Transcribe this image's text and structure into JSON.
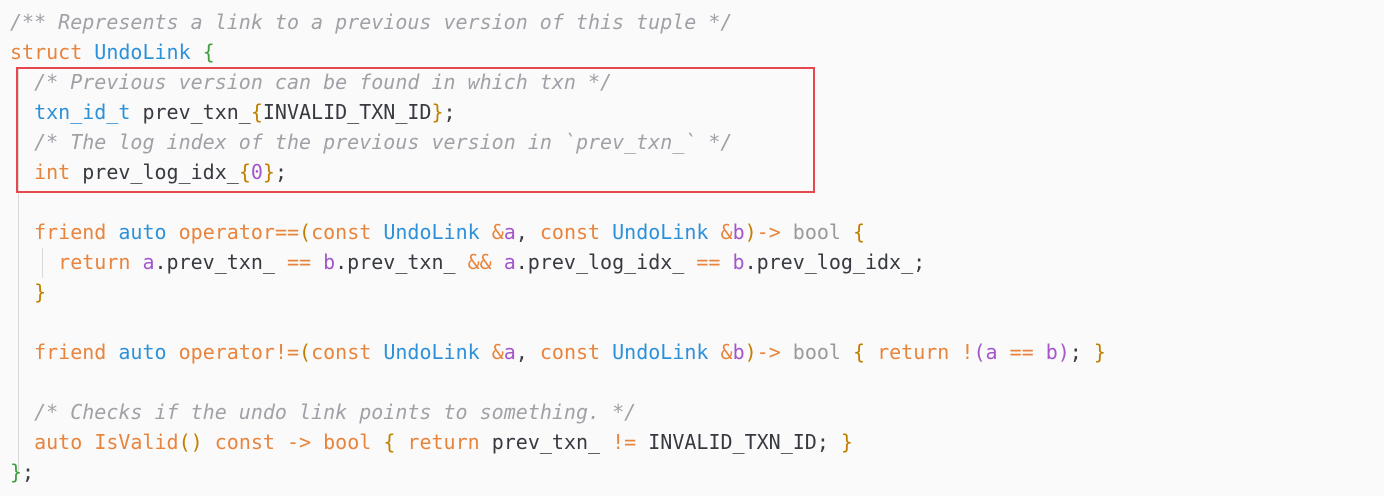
{
  "editor": {
    "language": "cpp",
    "highlight_color": "#e5484d",
    "lines": [
      {
        "id": "l1",
        "tokens": [
          [
            "cm",
            "/** Represents a link to a previous version of this tuple */"
          ]
        ]
      },
      {
        "id": "l2",
        "tokens": [
          [
            "kw",
            "struct "
          ],
          [
            "ty",
            "UndoLink "
          ],
          [
            "gr",
            "{"
          ]
        ]
      },
      {
        "id": "l3",
        "tokens": [
          [
            "pl",
            "  "
          ],
          [
            "cm",
            "/* Previous version can be found in which txn */"
          ]
        ]
      },
      {
        "id": "l4",
        "tokens": [
          [
            "pl",
            "  "
          ],
          [
            "ty",
            "txn_id_t "
          ],
          [
            "id",
            "prev_txn_"
          ],
          [
            "br1",
            "{"
          ],
          [
            "id",
            "INVALID_TXN_ID"
          ],
          [
            "br1",
            "}"
          ],
          [
            "pl",
            ";"
          ]
        ]
      },
      {
        "id": "l5",
        "tokens": [
          [
            "pl",
            "  "
          ],
          [
            "cm",
            "/* The log index of the previous version in `prev_txn_` */"
          ]
        ]
      },
      {
        "id": "l6",
        "tokens": [
          [
            "pl",
            "  "
          ],
          [
            "kw",
            "int "
          ],
          [
            "id",
            "prev_log_idx_"
          ],
          [
            "br1",
            "{"
          ],
          [
            "nm",
            "0"
          ],
          [
            "br1",
            "}"
          ],
          [
            "pl",
            ";"
          ]
        ]
      },
      {
        "id": "l7",
        "tokens": []
      },
      {
        "id": "l8",
        "tokens": [
          [
            "pl",
            "  "
          ],
          [
            "kw",
            "friend "
          ],
          [
            "ty",
            "auto "
          ],
          [
            "fn",
            "operator=="
          ],
          [
            "br1",
            "("
          ],
          [
            "kw",
            "const "
          ],
          [
            "ty",
            "UndoLink "
          ],
          [
            "ao",
            "&"
          ],
          [
            "vr",
            "a"
          ],
          [
            "pl",
            ", "
          ],
          [
            "kw",
            "const "
          ],
          [
            "ty",
            "UndoLink "
          ],
          [
            "ao",
            "&"
          ],
          [
            "vr",
            "b"
          ],
          [
            "br1",
            ")"
          ],
          [
            "op",
            "-> "
          ],
          [
            "tyb",
            "bool "
          ],
          [
            "br1",
            "{"
          ]
        ]
      },
      {
        "id": "l9",
        "tokens": [
          [
            "pl",
            "    "
          ],
          [
            "kw",
            "return "
          ],
          [
            "vr",
            "a"
          ],
          [
            "pl",
            ".prev_txn_ "
          ],
          [
            "op",
            "== "
          ],
          [
            "vr",
            "b"
          ],
          [
            "pl",
            ".prev_txn_ "
          ],
          [
            "op",
            "&& "
          ],
          [
            "vr",
            "a"
          ],
          [
            "pl",
            ".prev_log_idx_ "
          ],
          [
            "op",
            "== "
          ],
          [
            "vr",
            "b"
          ],
          [
            "pl",
            ".prev_log_idx_;"
          ]
        ]
      },
      {
        "id": "l10",
        "tokens": [
          [
            "pl",
            "  "
          ],
          [
            "br1",
            "}"
          ]
        ]
      },
      {
        "id": "l11",
        "tokens": []
      },
      {
        "id": "l12",
        "tokens": [
          [
            "pl",
            "  "
          ],
          [
            "kw",
            "friend "
          ],
          [
            "ty",
            "auto "
          ],
          [
            "fn",
            "operator!="
          ],
          [
            "br1",
            "("
          ],
          [
            "kw",
            "const "
          ],
          [
            "ty",
            "UndoLink "
          ],
          [
            "ao",
            "&"
          ],
          [
            "vr",
            "a"
          ],
          [
            "pl",
            ", "
          ],
          [
            "kw",
            "const "
          ],
          [
            "ty",
            "UndoLink "
          ],
          [
            "ao",
            "&"
          ],
          [
            "vr",
            "b"
          ],
          [
            "br1",
            ")"
          ],
          [
            "op",
            "-> "
          ],
          [
            "tyb",
            "bool "
          ],
          [
            "br1",
            "{ "
          ],
          [
            "kw",
            "return "
          ],
          [
            "op",
            "!"
          ],
          [
            "br2",
            "("
          ],
          [
            "vr",
            "a "
          ],
          [
            "op",
            "== "
          ],
          [
            "vr",
            "b"
          ],
          [
            "br2",
            ")"
          ],
          [
            "pl",
            "; "
          ],
          [
            "br1",
            "}"
          ]
        ]
      },
      {
        "id": "l13",
        "tokens": []
      },
      {
        "id": "l14",
        "tokens": [
          [
            "pl",
            "  "
          ],
          [
            "cm",
            "/* Checks if the undo link points to something. */"
          ]
        ]
      },
      {
        "id": "l15",
        "tokens": [
          [
            "pl",
            "  "
          ],
          [
            "kw",
            "auto "
          ],
          [
            "fn",
            "IsValid"
          ],
          [
            "br1",
            "() "
          ],
          [
            "kw",
            "const "
          ],
          [
            "op",
            "-> "
          ],
          [
            "kw",
            "bool "
          ],
          [
            "br1",
            "{ "
          ],
          [
            "kw",
            "return "
          ],
          [
            "id",
            "prev_txn_ "
          ],
          [
            "op",
            "!= "
          ],
          [
            "id",
            "INVALID_TXN_ID; "
          ],
          [
            "br1",
            "}"
          ]
        ]
      },
      {
        "id": "l16",
        "tokens": [
          [
            "gr",
            "}"
          ],
          [
            "pl",
            ";"
          ]
        ]
      }
    ]
  }
}
